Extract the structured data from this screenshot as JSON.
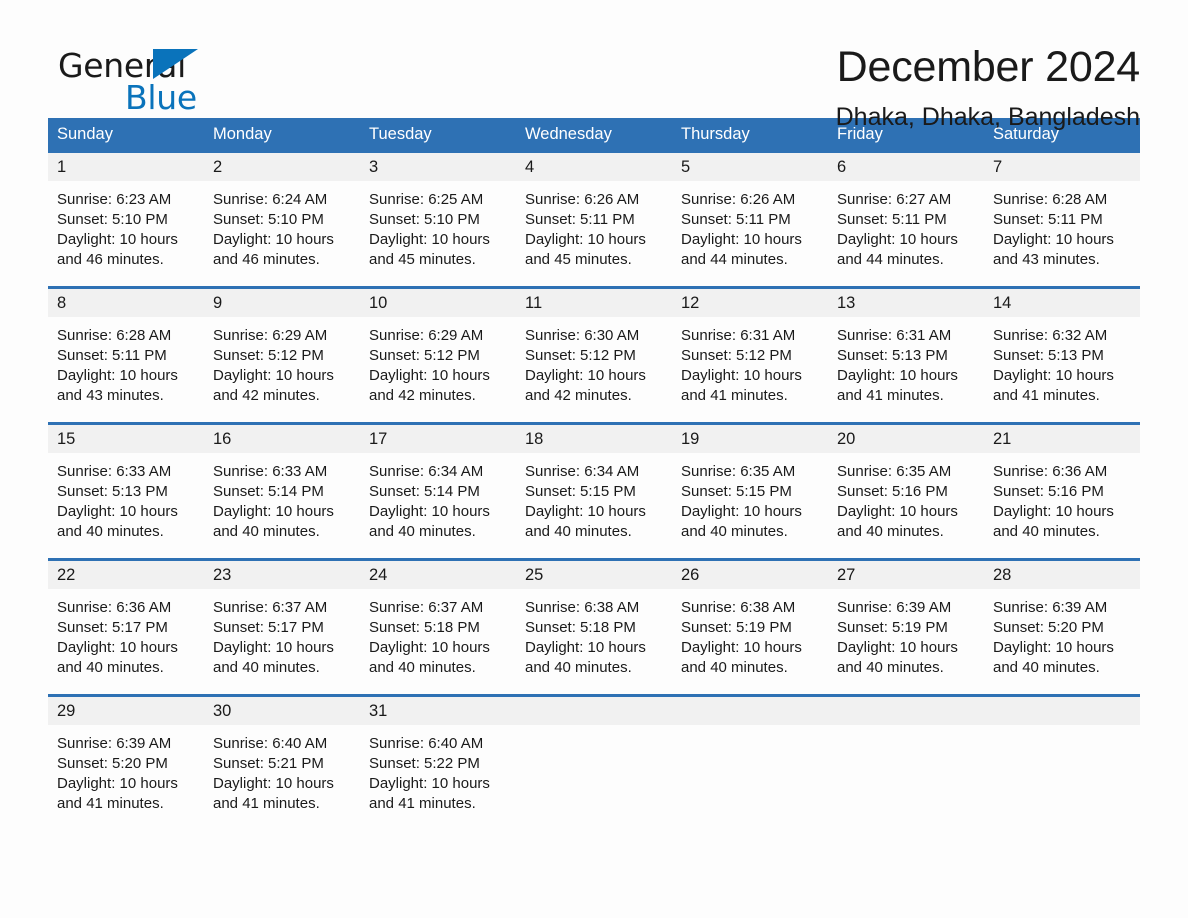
{
  "brand": {
    "name_part1": "General",
    "name_part2": "Blue",
    "triangle_color": "#0a73bb"
  },
  "header": {
    "month_title": "December 2024",
    "location": "Dhaka, Dhaka, Bangladesh"
  },
  "colors": {
    "header_blue": "#2e71b4",
    "daynum_band": "#f1f1f1",
    "page_background": "#fdfdfd",
    "text": "#1a1a1a"
  },
  "weekdays": [
    "Sunday",
    "Monday",
    "Tuesday",
    "Wednesday",
    "Thursday",
    "Friday",
    "Saturday"
  ],
  "weeks": [
    {
      "days": [
        {
          "num": "1",
          "sunrise": "Sunrise: 6:23 AM",
          "sunset": "Sunset: 5:10 PM",
          "daylight": "Daylight: 10 hours and 46 minutes."
        },
        {
          "num": "2",
          "sunrise": "Sunrise: 6:24 AM",
          "sunset": "Sunset: 5:10 PM",
          "daylight": "Daylight: 10 hours and 46 minutes."
        },
        {
          "num": "3",
          "sunrise": "Sunrise: 6:25 AM",
          "sunset": "Sunset: 5:10 PM",
          "daylight": "Daylight: 10 hours and 45 minutes."
        },
        {
          "num": "4",
          "sunrise": "Sunrise: 6:26 AM",
          "sunset": "Sunset: 5:11 PM",
          "daylight": "Daylight: 10 hours and 45 minutes."
        },
        {
          "num": "5",
          "sunrise": "Sunrise: 6:26 AM",
          "sunset": "Sunset: 5:11 PM",
          "daylight": "Daylight: 10 hours and 44 minutes."
        },
        {
          "num": "6",
          "sunrise": "Sunrise: 6:27 AM",
          "sunset": "Sunset: 5:11 PM",
          "daylight": "Daylight: 10 hours and 44 minutes."
        },
        {
          "num": "7",
          "sunrise": "Sunrise: 6:28 AM",
          "sunset": "Sunset: 5:11 PM",
          "daylight": "Daylight: 10 hours and 43 minutes."
        }
      ]
    },
    {
      "days": [
        {
          "num": "8",
          "sunrise": "Sunrise: 6:28 AM",
          "sunset": "Sunset: 5:11 PM",
          "daylight": "Daylight: 10 hours and 43 minutes."
        },
        {
          "num": "9",
          "sunrise": "Sunrise: 6:29 AM",
          "sunset": "Sunset: 5:12 PM",
          "daylight": "Daylight: 10 hours and 42 minutes."
        },
        {
          "num": "10",
          "sunrise": "Sunrise: 6:29 AM",
          "sunset": "Sunset: 5:12 PM",
          "daylight": "Daylight: 10 hours and 42 minutes."
        },
        {
          "num": "11",
          "sunrise": "Sunrise: 6:30 AM",
          "sunset": "Sunset: 5:12 PM",
          "daylight": "Daylight: 10 hours and 42 minutes."
        },
        {
          "num": "12",
          "sunrise": "Sunrise: 6:31 AM",
          "sunset": "Sunset: 5:12 PM",
          "daylight": "Daylight: 10 hours and 41 minutes."
        },
        {
          "num": "13",
          "sunrise": "Sunrise: 6:31 AM",
          "sunset": "Sunset: 5:13 PM",
          "daylight": "Daylight: 10 hours and 41 minutes."
        },
        {
          "num": "14",
          "sunrise": "Sunrise: 6:32 AM",
          "sunset": "Sunset: 5:13 PM",
          "daylight": "Daylight: 10 hours and 41 minutes."
        }
      ]
    },
    {
      "days": [
        {
          "num": "15",
          "sunrise": "Sunrise: 6:33 AM",
          "sunset": "Sunset: 5:13 PM",
          "daylight": "Daylight: 10 hours and 40 minutes."
        },
        {
          "num": "16",
          "sunrise": "Sunrise: 6:33 AM",
          "sunset": "Sunset: 5:14 PM",
          "daylight": "Daylight: 10 hours and 40 minutes."
        },
        {
          "num": "17",
          "sunrise": "Sunrise: 6:34 AM",
          "sunset": "Sunset: 5:14 PM",
          "daylight": "Daylight: 10 hours and 40 minutes."
        },
        {
          "num": "18",
          "sunrise": "Sunrise: 6:34 AM",
          "sunset": "Sunset: 5:15 PM",
          "daylight": "Daylight: 10 hours and 40 minutes."
        },
        {
          "num": "19",
          "sunrise": "Sunrise: 6:35 AM",
          "sunset": "Sunset: 5:15 PM",
          "daylight": "Daylight: 10 hours and 40 minutes."
        },
        {
          "num": "20",
          "sunrise": "Sunrise: 6:35 AM",
          "sunset": "Sunset: 5:16 PM",
          "daylight": "Daylight: 10 hours and 40 minutes."
        },
        {
          "num": "21",
          "sunrise": "Sunrise: 6:36 AM",
          "sunset": "Sunset: 5:16 PM",
          "daylight": "Daylight: 10 hours and 40 minutes."
        }
      ]
    },
    {
      "days": [
        {
          "num": "22",
          "sunrise": "Sunrise: 6:36 AM",
          "sunset": "Sunset: 5:17 PM",
          "daylight": "Daylight: 10 hours and 40 minutes."
        },
        {
          "num": "23",
          "sunrise": "Sunrise: 6:37 AM",
          "sunset": "Sunset: 5:17 PM",
          "daylight": "Daylight: 10 hours and 40 minutes."
        },
        {
          "num": "24",
          "sunrise": "Sunrise: 6:37 AM",
          "sunset": "Sunset: 5:18 PM",
          "daylight": "Daylight: 10 hours and 40 minutes."
        },
        {
          "num": "25",
          "sunrise": "Sunrise: 6:38 AM",
          "sunset": "Sunset: 5:18 PM",
          "daylight": "Daylight: 10 hours and 40 minutes."
        },
        {
          "num": "26",
          "sunrise": "Sunrise: 6:38 AM",
          "sunset": "Sunset: 5:19 PM",
          "daylight": "Daylight: 10 hours and 40 minutes."
        },
        {
          "num": "27",
          "sunrise": "Sunrise: 6:39 AM",
          "sunset": "Sunset: 5:19 PM",
          "daylight": "Daylight: 10 hours and 40 minutes."
        },
        {
          "num": "28",
          "sunrise": "Sunrise: 6:39 AM",
          "sunset": "Sunset: 5:20 PM",
          "daylight": "Daylight: 10 hours and 40 minutes."
        }
      ]
    },
    {
      "days": [
        {
          "num": "29",
          "sunrise": "Sunrise: 6:39 AM",
          "sunset": "Sunset: 5:20 PM",
          "daylight": "Daylight: 10 hours and 41 minutes."
        },
        {
          "num": "30",
          "sunrise": "Sunrise: 6:40 AM",
          "sunset": "Sunset: 5:21 PM",
          "daylight": "Daylight: 10 hours and 41 minutes."
        },
        {
          "num": "31",
          "sunrise": "Sunrise: 6:40 AM",
          "sunset": "Sunset: 5:22 PM",
          "daylight": "Daylight: 10 hours and 41 minutes."
        },
        {
          "num": "",
          "sunrise": "",
          "sunset": "",
          "daylight": ""
        },
        {
          "num": "",
          "sunrise": "",
          "sunset": "",
          "daylight": ""
        },
        {
          "num": "",
          "sunrise": "",
          "sunset": "",
          "daylight": ""
        },
        {
          "num": "",
          "sunrise": "",
          "sunset": "",
          "daylight": ""
        }
      ]
    }
  ]
}
